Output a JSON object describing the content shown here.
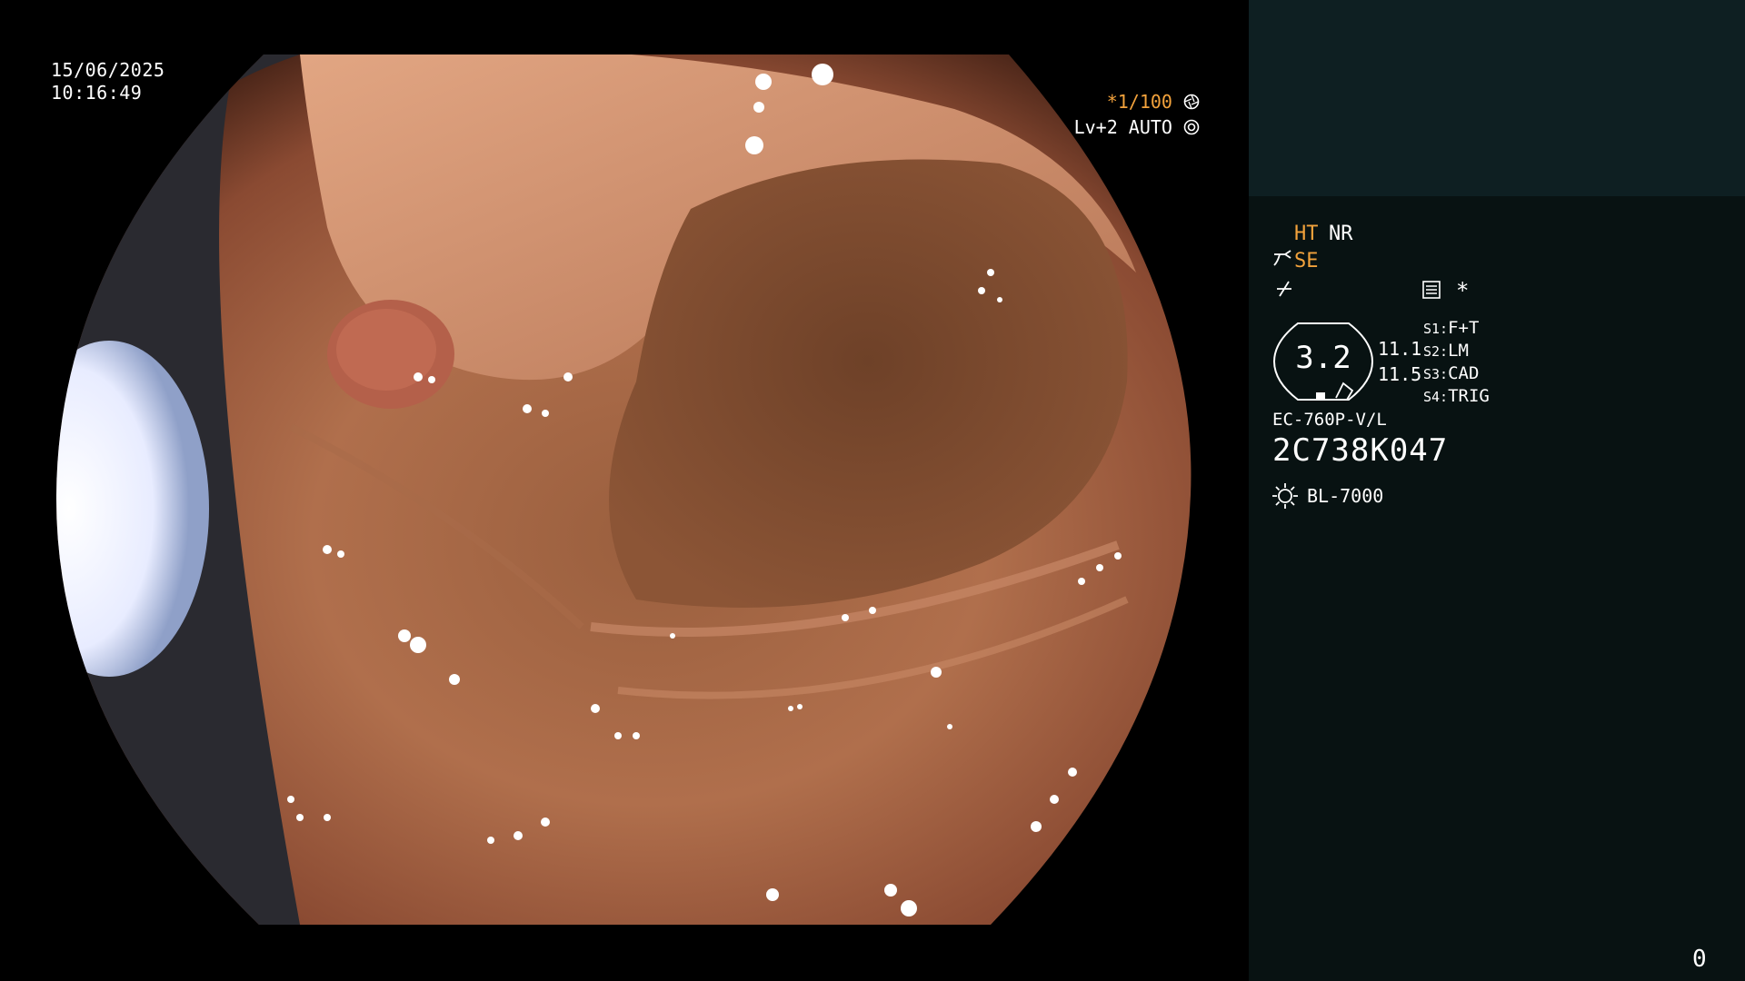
{
  "overlay": {
    "date": "15/06/2025",
    "time": "10:16:49",
    "shutter": "*1/100",
    "level": "Lv+2 AUTO"
  },
  "panel": {
    "ht": "HT",
    "nr": "NR",
    "se": "SE",
    "dial_value": "3.2",
    "value_a": "11.1",
    "value_b": "11.5",
    "switches": [
      {
        "key": "S1:",
        "value": "F+T"
      },
      {
        "key": "S2:",
        "value": "LM"
      },
      {
        "key": "S3:",
        "value": "CAD"
      },
      {
        "key": "S4:",
        "value": "TRIG"
      }
    ],
    "star": "*",
    "scope_model": "EC-760P-V/L",
    "scope_serial": "2C738K047",
    "light_source": "BL-7000",
    "counter": "0"
  },
  "colors": {
    "highlight": "#f2a23c",
    "panel_bg": "#081212",
    "panel_top_bg": "#0e1f22",
    "text": "#ffffff"
  },
  "icons": {
    "shutter": "aperture-icon",
    "level": "iris-icon",
    "se": "scope-tip-icon",
    "edge": "edge-enhance-icon",
    "menu": "menu-list-icon",
    "light": "sun-icon"
  }
}
